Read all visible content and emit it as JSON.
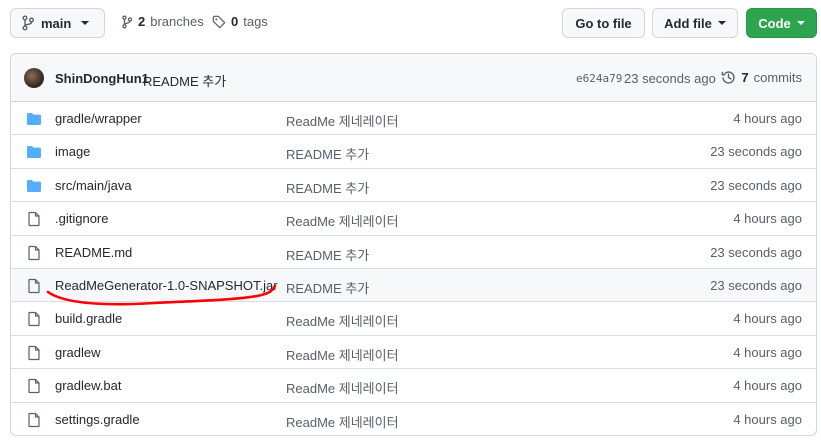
{
  "branch": {
    "name": "main"
  },
  "branches": {
    "count": "2",
    "label": "branches"
  },
  "tags": {
    "count": "0",
    "label": "tags"
  },
  "buttons": {
    "goto_file": "Go to file",
    "add_file": "Add file",
    "code": "Code"
  },
  "commit": {
    "author": "ShinDongHun1",
    "message": "README 추가",
    "sha": "e624a79",
    "time": "23 seconds ago",
    "commits_count": "7",
    "commits_label": "commits"
  },
  "files": [
    {
      "type": "folder",
      "name": "gradle/wrapper",
      "message": "ReadMe 제네레이터",
      "age": "4 hours ago"
    },
    {
      "type": "folder",
      "name": "image",
      "message": "README 추가",
      "age": "23 seconds ago"
    },
    {
      "type": "folder",
      "name": "src/main/java",
      "message": "README 추가",
      "age": "23 seconds ago"
    },
    {
      "type": "file",
      "name": ".gitignore",
      "message": "ReadMe 제네레이터",
      "age": "4 hours ago"
    },
    {
      "type": "file",
      "name": "README.md",
      "message": "README 추가",
      "age": "23 seconds ago"
    },
    {
      "type": "file",
      "name": "ReadMeGenerator-1.0-SNAPSHOT.jar",
      "message": "README 추가",
      "age": "23 seconds ago",
      "highlighted": true
    },
    {
      "type": "file",
      "name": "build.gradle",
      "message": "ReadMe 제네레이터",
      "age": "4 hours ago"
    },
    {
      "type": "file",
      "name": "gradlew",
      "message": "ReadMe 제네레이터",
      "age": "4 hours ago"
    },
    {
      "type": "file",
      "name": "gradlew.bat",
      "message": "ReadMe 제네레이터",
      "age": "4 hours ago"
    },
    {
      "type": "file",
      "name": "settings.gradle",
      "message": "ReadMe 제네레이터",
      "age": "4 hours ago"
    }
  ],
  "colors": {
    "folder": "#54aeff",
    "accent_green": "#2da44e",
    "annotation_red": "#ff0000"
  }
}
